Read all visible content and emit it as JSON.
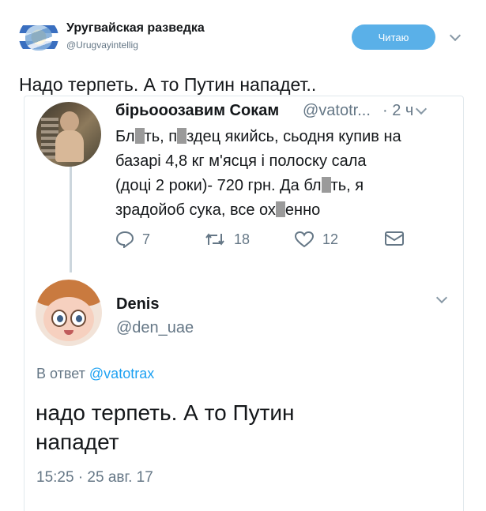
{
  "outer_tweet": {
    "name": "Уругвайская разведка",
    "handle": "@Urugvayintellig",
    "follow_label": "Читаю",
    "text": "Надо терпеть. А то Путин нападет.."
  },
  "quoted_tweet": {
    "name": "бірьооозавим Сокам",
    "handle": "@vatotr...",
    "time": "· 2 ч",
    "text_line1_a": "Бл",
    "text_line1_b": "ть, п",
    "text_line1_c": "здец якийсь, сьодня купив на",
    "text_line2": "базарі 4,8 кг м'ясця і полоску сала",
    "text_line3_a": "(доці 2 роки)- 720 грн. Да бл",
    "text_line3_b": "ть, я",
    "text_line4_a": "зрадойоб сука, все ох",
    "text_line4_b": "енно",
    "replies": "7",
    "retweets": "18",
    "likes": "12"
  },
  "reply_tweet": {
    "name": "Denis",
    "handle": "@den_uae",
    "reply_prefix": "В ответ",
    "reply_mention": "@vatotrax",
    "text_line1": "надо терпеть. А то Путин",
    "text_line2": "нападет",
    "date": "15:25 · 25 авг. 17"
  },
  "icons": {
    "reply": "reply-icon",
    "retweet": "retweet-icon",
    "like": "heart-icon",
    "dm": "envelope-icon",
    "menu": "chevron-down-icon"
  },
  "colors": {
    "follow_button": "#5ab0e8",
    "link": "#1da1f2",
    "secondary_text": "#657786"
  }
}
